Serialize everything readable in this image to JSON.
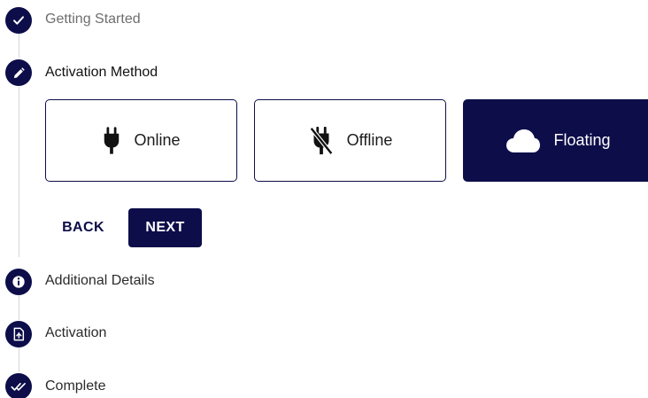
{
  "steps": [
    {
      "label": "Getting Started",
      "state": "completed",
      "icon": "check-icon"
    },
    {
      "label": "Activation Method",
      "state": "active",
      "icon": "pencil-icon"
    },
    {
      "label": "Additional Details",
      "state": "pending",
      "icon": "info-icon"
    },
    {
      "label": "Activation",
      "state": "pending",
      "icon": "document-icon"
    },
    {
      "label": "Complete",
      "state": "pending",
      "icon": "double-check-icon"
    }
  ],
  "activation_options": [
    {
      "label": "Online",
      "icon": "plug-icon",
      "selected": false
    },
    {
      "label": "Offline",
      "icon": "plug-off-icon",
      "selected": false
    },
    {
      "label": "Floating",
      "icon": "cloud-icon",
      "selected": true
    }
  ],
  "buttons": {
    "back_label": "BACK",
    "next_label": "NEXT"
  },
  "colors": {
    "primary": "#0d0d4a",
    "connector": "#d6d6d6",
    "completed_text": "#6e6e6e"
  }
}
